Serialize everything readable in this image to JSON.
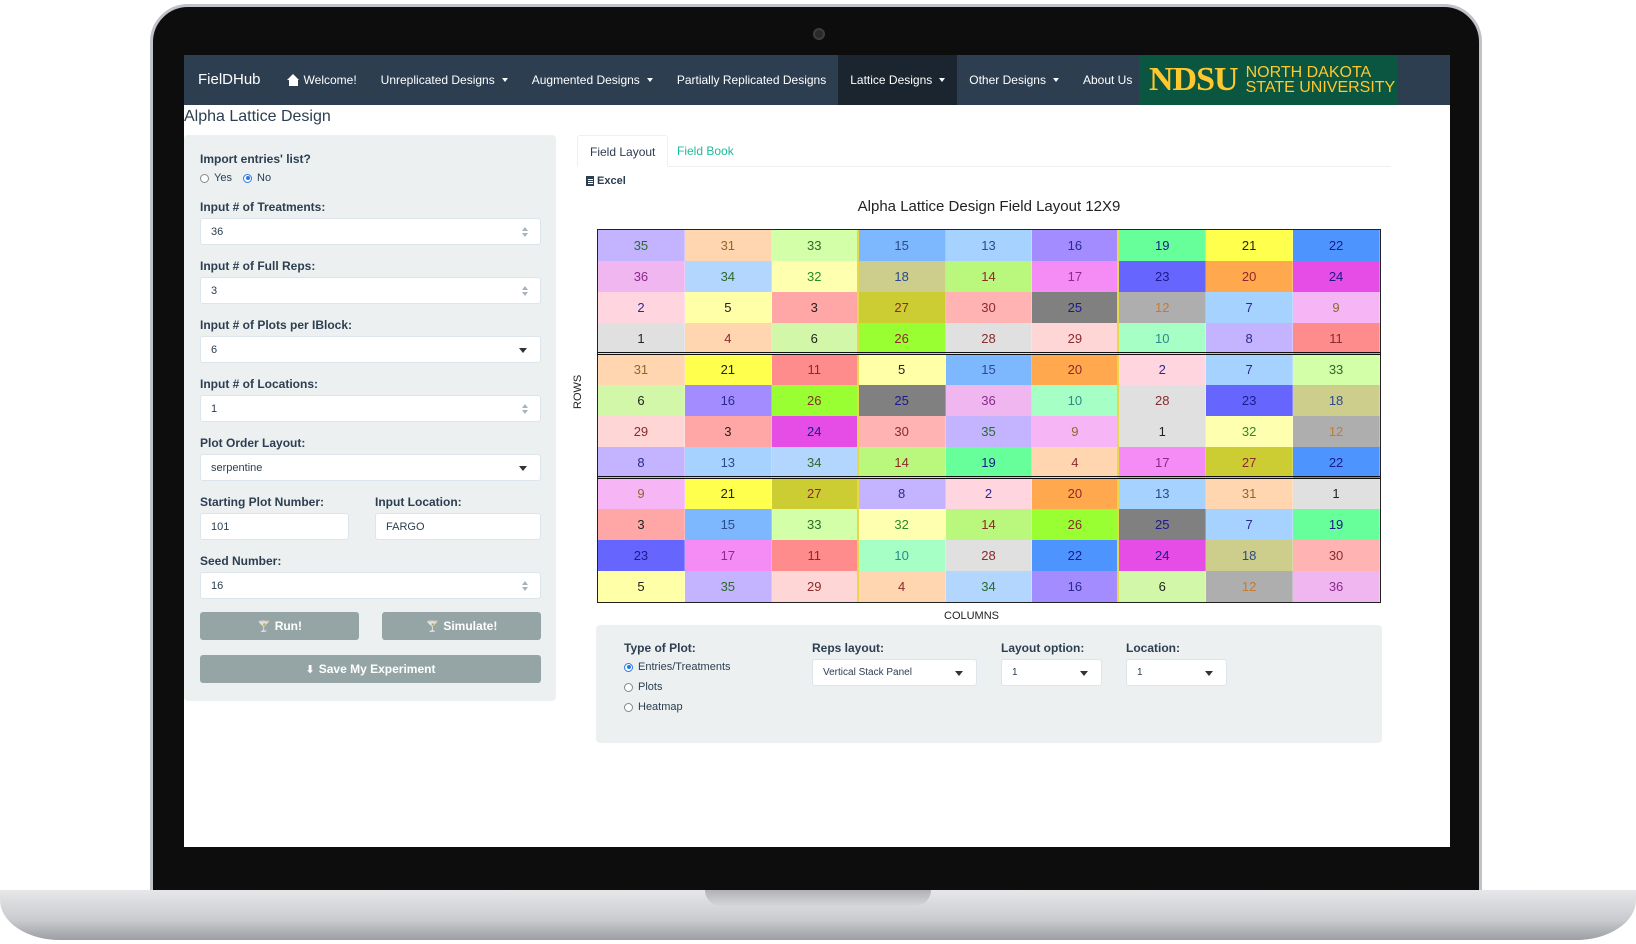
{
  "navbar": {
    "brand": "FielDHub",
    "items": [
      {
        "label": "Welcome!",
        "icon": "home-icon",
        "dropdown": false
      },
      {
        "label": "Unreplicated Designs",
        "dropdown": true
      },
      {
        "label": "Augmented Designs",
        "dropdown": true
      },
      {
        "label": "Partially Replicated Designs",
        "dropdown": false
      },
      {
        "label": "Lattice Designs",
        "dropdown": true,
        "active": true
      },
      {
        "label": "Other Designs",
        "dropdown": true
      },
      {
        "label": "About Us",
        "dropdown": false
      }
    ],
    "logo": {
      "acronym": "NDSU",
      "line1": "North Dakota",
      "line2": "State University"
    }
  },
  "page_title": "Alpha Lattice Design",
  "sidebar": {
    "import_label": "Import entries' list?",
    "import_options": [
      "Yes",
      "No"
    ],
    "import_selected": "No",
    "treatments_label": "Input # of Treatments:",
    "treatments_value": "36",
    "full_reps_label": "Input # of Full Reps:",
    "full_reps_value": "3",
    "plots_per_iblock_label": "Input # of Plots per IBlock:",
    "plots_per_iblock_value": "6",
    "locations_label": "Input # of Locations:",
    "locations_value": "1",
    "plot_order_label": "Plot Order Layout:",
    "plot_order_value": "serpentine",
    "starting_plot_label": "Starting Plot Number:",
    "starting_plot_value": "101",
    "input_location_label": "Input Location:",
    "input_location_value": "FARGO",
    "seed_label": "Seed Number:",
    "seed_value": "16",
    "run_label": "Run!",
    "simulate_label": "Simulate!",
    "save_label": "Save My Experiment"
  },
  "tabs": {
    "field_layout": "Field Layout",
    "field_book": "Field Book",
    "active": "Field Layout"
  },
  "excel_label": "Excel",
  "chart_data": {
    "type": "heatmap",
    "title": "Alpha Lattice Design Field Layout 12X9",
    "xlabel": "COLUMNS",
    "ylabel": "ROWS",
    "rep_boundaries_after_rows": [
      4,
      8
    ],
    "rows": [
      [
        35,
        31,
        33,
        15,
        13,
        16,
        19,
        21,
        22
      ],
      [
        36,
        34,
        32,
        18,
        14,
        17,
        23,
        20,
        24
      ],
      [
        2,
        5,
        3,
        27,
        30,
        25,
        12,
        7,
        9
      ],
      [
        1,
        4,
        6,
        26,
        28,
        29,
        10,
        8,
        11
      ],
      [
        31,
        21,
        11,
        5,
        15,
        20,
        2,
        7,
        33
      ],
      [
        6,
        16,
        26,
        25,
        36,
        10,
        28,
        23,
        18
      ],
      [
        29,
        3,
        24,
        30,
        35,
        9,
        1,
        32,
        12
      ],
      [
        8,
        13,
        34,
        14,
        19,
        4,
        17,
        27,
        22
      ],
      [
        9,
        21,
        27,
        8,
        2,
        20,
        13,
        31,
        1
      ],
      [
        3,
        15,
        33,
        32,
        14,
        26,
        25,
        7,
        19
      ],
      [
        23,
        17,
        11,
        10,
        28,
        22,
        24,
        18,
        30
      ],
      [
        5,
        35,
        29,
        4,
        34,
        16,
        6,
        12,
        36
      ]
    ],
    "treatment_colors": {
      "1": "#e0e0e0",
      "2": "#ffd6e0",
      "3": "#ffa6a6",
      "4": "#ffd6b0",
      "5": "#ffffa8",
      "6": "#d2f7a8",
      "7": "#a6d2ff",
      "8": "#c4b4ff",
      "9": "#f6b6f6",
      "10": "#a6ffc4",
      "11": "#ff8c8c",
      "12": "#aeaeae",
      "13": "#a6d2ff",
      "14": "#baf77d",
      "15": "#7db8ff",
      "16": "#a38cff",
      "17": "#f58cf5",
      "18": "#cdcd8c",
      "19": "#66ff99",
      "20": "#ffa84d",
      "21": "#ffff4d",
      "22": "#4d94ff",
      "23": "#6666ff",
      "24": "#e64de6",
      "25": "#808080",
      "26": "#99ff33",
      "27": "#cccc33",
      "28": "#e0e0e0",
      "29": "#ffd6d6",
      "30": "#ffb3b3",
      "31": "#ffd6b0",
      "32": "#ffffb0",
      "33": "#d2ffa8",
      "34": "#b3d6ff",
      "35": "#c4b4ff",
      "36": "#f0b6f0"
    },
    "treatment_text_colors": {
      "1": "#222222",
      "2": "#2a2a8a",
      "3": "#222222",
      "4": "#8a2a2a",
      "5": "#222222",
      "6": "#222222",
      "7": "#2a2a8a",
      "8": "#2a2a8a",
      "9": "#8a6a2a",
      "10": "#2a8a8a",
      "11": "#8a2a2a",
      "12": "#c87a2a",
      "13": "#2a4a8a",
      "14": "#8a2a2a",
      "15": "#2a4a8a",
      "16": "#2a2a8a",
      "17": "#8a2a8a",
      "18": "#2a4a8a",
      "19": "#1a1a8a",
      "20": "#8a2a2a",
      "21": "#222222",
      "22": "#1a1a8a",
      "23": "#1a1a8a",
      "24": "#1a1a8a",
      "25": "#1a1a8a",
      "26": "#8a2a2a",
      "27": "#8a2a2a",
      "28": "#8a2a2a",
      "29": "#8a2a2a",
      "30": "#8a2a2a",
      "31": "#8a6a2a",
      "32": "#2a8a2a",
      "33": "#2a6a2a",
      "34": "#2a6a2a",
      "35": "#2a6a2a",
      "36": "#8a2a8a"
    }
  },
  "controls": {
    "type_of_plot_label": "Type of Plot:",
    "type_of_plot_options": [
      "Entries/Treatments",
      "Plots",
      "Heatmap"
    ],
    "type_of_plot_selected": "Entries/Treatments",
    "reps_layout_label": "Reps layout:",
    "reps_layout_value": "Vertical Stack Panel",
    "layout_option_label": "Layout option:",
    "layout_option_value": "1",
    "location_label": "Location:",
    "location_value": "1"
  }
}
